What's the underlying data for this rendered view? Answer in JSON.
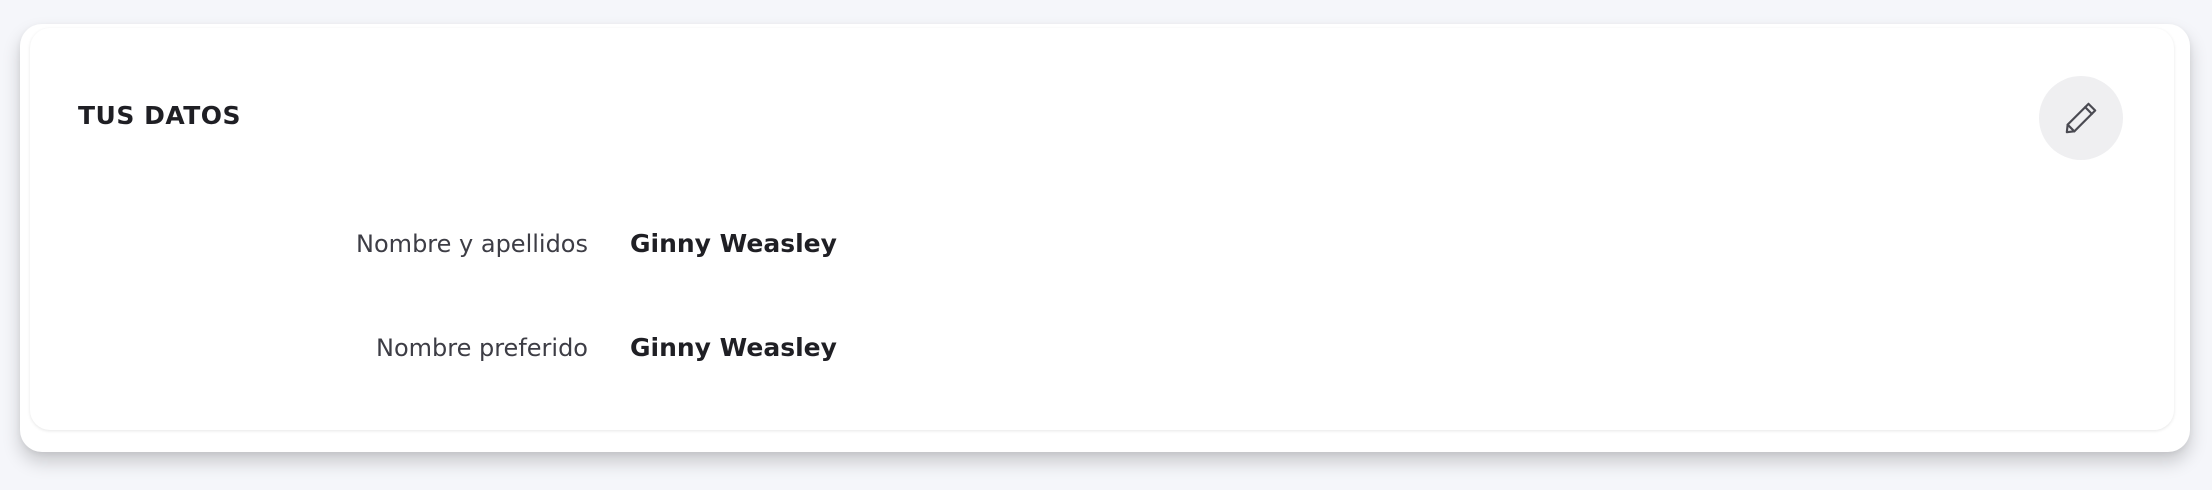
{
  "card": {
    "title": "TUS DATOS",
    "edit_icon": "pencil-icon",
    "fields": [
      {
        "label": "Nombre y apellidos",
        "value": "Ginny Weasley"
      },
      {
        "label": "Nombre preferido",
        "value": "Ginny Weasley"
      }
    ]
  },
  "colors": {
    "page_background": "#f5f6fa",
    "card_background": "#ffffff",
    "edit_button_background": "#efeff1",
    "text_primary": "#1f1f24",
    "text_secondary": "#3d3d45"
  }
}
